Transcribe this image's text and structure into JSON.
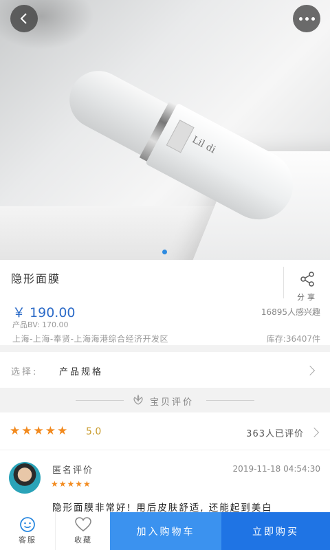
{
  "hero": {
    "bottle_label": "Lil  di",
    "image_desc": "product-photo"
  },
  "product": {
    "title": "隐形面膜",
    "share_label": "分享",
    "price": "￥ 190.00",
    "interest": "16895人感兴趣",
    "bv": "产品BV: 170.00",
    "address": "上海-上海-奉贤-上海海港综合经济开发区",
    "stock": "库存:36407件"
  },
  "select": {
    "label": "选择:",
    "value": "产品规格"
  },
  "reviews_header": {
    "title": "宝贝评价"
  },
  "rating": {
    "stars": "★★★★★",
    "score": "5.0",
    "count_text": "363人已评价"
  },
  "review": {
    "reviewer": "匿名评价",
    "stars": "★★★★★",
    "time": "2019-11-18 04:54:30",
    "text": "隐形面膜非常好! 用后皮肤舒适, 还能起到美白"
  },
  "bottom": {
    "service_label": "客服",
    "favorite_label": "收藏",
    "cart_label": "加入购物车",
    "buy_label": "立即购买"
  },
  "colors": {
    "accent": "#1f74e4",
    "price": "#2e6cc8",
    "star": "#f28a1e"
  }
}
